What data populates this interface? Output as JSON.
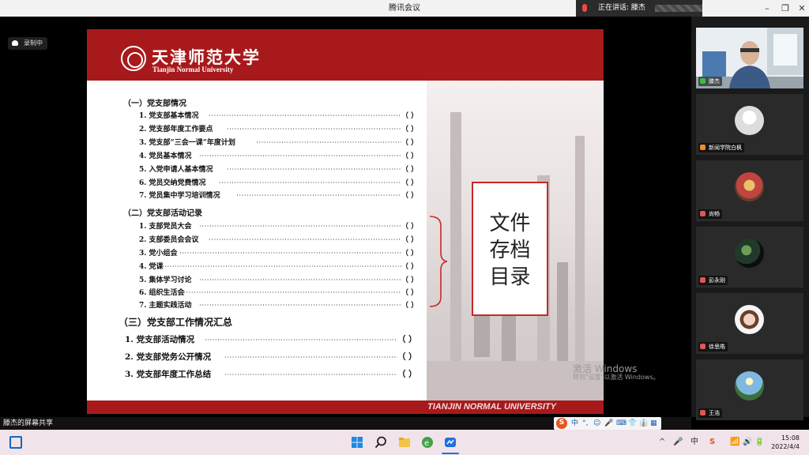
{
  "window": {
    "title": "腾讯会议",
    "speaking_label": "正在讲话: 滕杰",
    "controls": [
      "–",
      "❐",
      "✕"
    ]
  },
  "recording": {
    "label": "录制中"
  },
  "slide": {
    "university_cn": "天津师范大学",
    "university_en": "Tianjin Normal University",
    "footer": "TIANJIN NORMAL UNIVERSITY",
    "sections": [
      {
        "heading": "（一）党支部情况",
        "items": [
          "1. 党支部基本情况",
          "2. 党支部年度工作要点",
          "3. 党支部“三会一课”年度计划",
          "4. 党员基本情况",
          "5. 入党申请人基本情况",
          "6. 党员交纳党费情况",
          "7. 党员集中学习培训情况"
        ]
      },
      {
        "heading": "（二）党支部活动记录",
        "items": [
          "1. 支部党员大会",
          "2. 支部委员会会议",
          "3. 党小组会",
          "4. 党课",
          "5. 集体学习讨论",
          "6. 组织生活会",
          "7. 主题实践活动"
        ]
      },
      {
        "heading": "（三）党支部工作情况汇总",
        "items": [
          "1. 党支部活动情况",
          "2. 党支部党务公开情况",
          "3. 党支部年度工作总结"
        ]
      }
    ],
    "paren": "（    ）",
    "box_lines": [
      "文件",
      "存档",
      "目录"
    ]
  },
  "watermark": {
    "line1": "激活 Windows",
    "line2": "转到\"设置\"以激活 Windows。"
  },
  "participants": [
    {
      "name": "滕杰",
      "type": "video"
    },
    {
      "name": "新闻学院白枫",
      "type": "avatar"
    },
    {
      "name": "尚畅",
      "type": "avatar"
    },
    {
      "name": "彭永刚",
      "type": "avatar"
    },
    {
      "name": "徐思皓",
      "type": "avatar"
    },
    {
      "name": "王浩",
      "type": "avatar"
    }
  ],
  "share_label": "滕杰的屏幕共享",
  "ime": {
    "logo": "S",
    "items": [
      "中",
      "°,",
      "☺",
      "🎤",
      "⌨",
      "👕",
      "👔",
      "▦"
    ]
  },
  "taskbar": {
    "apps": [
      "start-icon",
      "search-icon",
      "file-explorer-icon",
      "browser-icon",
      "meeting-icon"
    ],
    "tray": [
      "^",
      "🎤",
      "中",
      "S",
      "📶",
      "🔊",
      "🔋"
    ],
    "time": "15:08",
    "date": "2022/4/4"
  },
  "colors": {
    "brand_red": "#a8191b",
    "box_border": "#c62828"
  }
}
